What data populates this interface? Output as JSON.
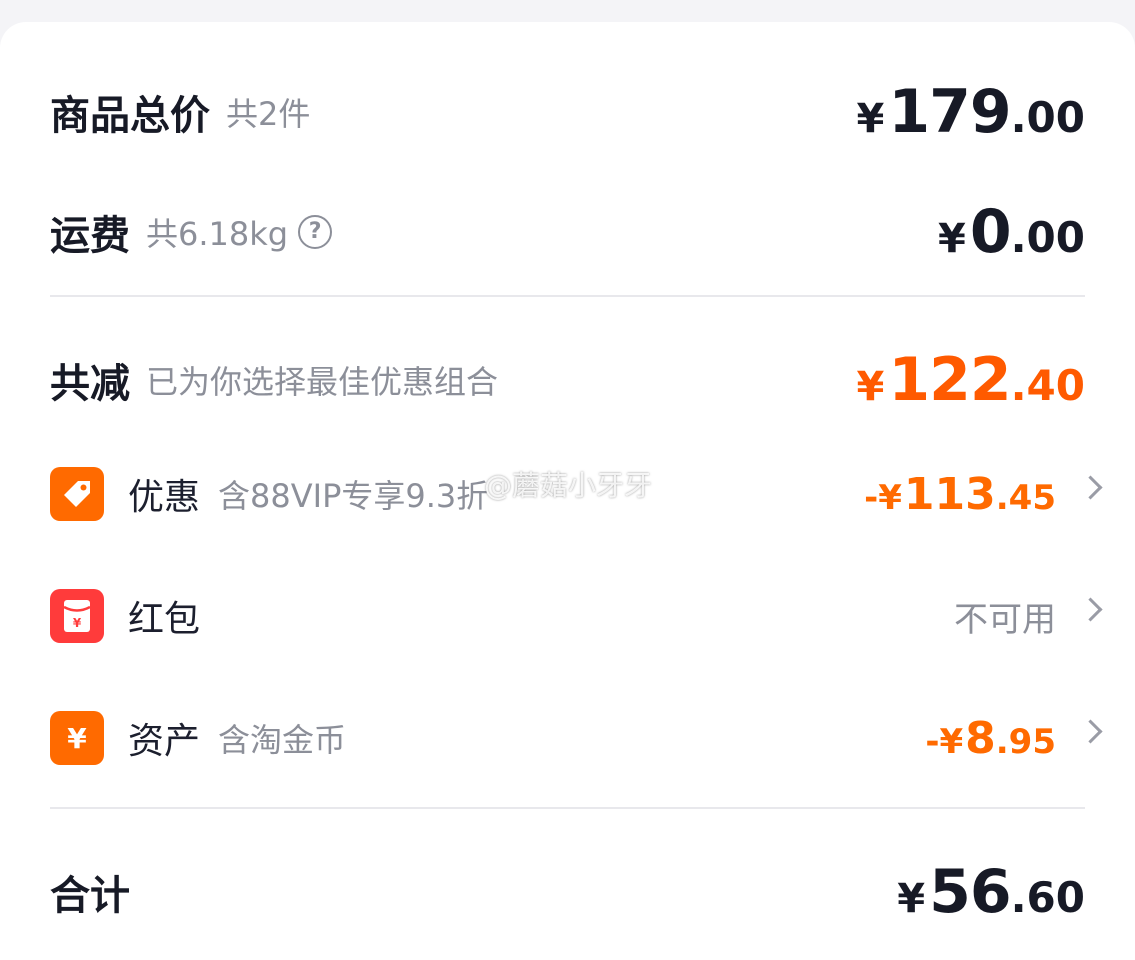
{
  "summary": {
    "goods_total": {
      "label": "商品总价",
      "note": "共2件",
      "symbol": "¥",
      "int": "179",
      "dec": ".00"
    },
    "shipping": {
      "label": "运费",
      "note": "共6.18kg",
      "help_glyph": "?",
      "symbol": "¥",
      "int": "0",
      "dec": ".00"
    },
    "discount_total": {
      "label": "共减",
      "note": "已为你选择最佳优惠组合",
      "symbol": "¥",
      "int": "122",
      "dec": ".40"
    }
  },
  "items": [
    {
      "label": "优惠",
      "note": "含88VIP专享9.3折",
      "prefix": "-¥",
      "int": "113",
      "dec": ".45",
      "icon": "tag-icon"
    },
    {
      "label": "红包",
      "status": "不可用",
      "icon": "red-packet-icon"
    },
    {
      "label": "资产",
      "note": "含淘金币",
      "prefix": "-¥",
      "int": "8",
      "dec": ".95",
      "icon": "yuan-coin-icon"
    }
  ],
  "total": {
    "label": "合计",
    "symbol": "¥",
    "int": "56",
    "dec": ".60"
  },
  "watermark": "@蘑菇小牙牙",
  "colors": {
    "accent": "#ff5a00",
    "icon_orange": "#ff6a00",
    "icon_red": "#ff3b3b",
    "muted": "#8c8f99"
  }
}
